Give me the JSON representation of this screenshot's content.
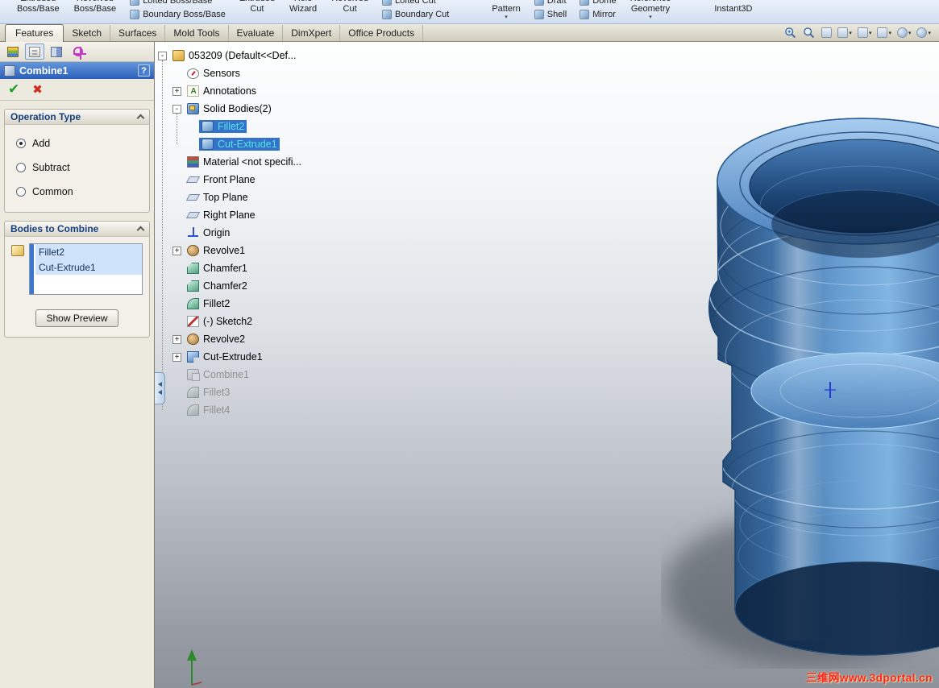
{
  "glyphs": {
    "dropdown": "▾",
    "ok": "✔",
    "cancel": "✖",
    "help": "?",
    "collapse": "-",
    "expand": "+"
  },
  "ribbon": {
    "items": [
      {
        "style": "big",
        "top": "Extruded",
        "bottom": "Boss/Base",
        "dropdown": false
      },
      {
        "style": "big",
        "top": "Revolved",
        "bottom": "Boss/Base",
        "dropdown": false
      },
      {
        "style": "stack",
        "top": "Lofted Boss/Base",
        "bottom": "Boundary Boss/Base"
      },
      {
        "style": "big",
        "top": "Extruded",
        "bottom": "Cut",
        "dropdown": false
      },
      {
        "style": "big",
        "top": "Hole",
        "bottom": "Wizard",
        "dropdown": false
      },
      {
        "style": "big",
        "top": "Revolved",
        "bottom": "Cut",
        "dropdown": false
      },
      {
        "style": "stack",
        "top": "Lofted Cut",
        "bottom": "Boundary Cut"
      },
      {
        "style": "big",
        "top": "",
        "bottom": "Pattern",
        "dropdown": true,
        "gap_before": true
      },
      {
        "style": "stack",
        "top": "Draft",
        "bottom": "Shell"
      },
      {
        "style": "stack",
        "top": "Dome",
        "bottom": "Mirror"
      },
      {
        "style": "big",
        "top": "Reference",
        "bottom": "Geometry",
        "dropdown": true
      },
      {
        "style": "big",
        "top": "",
        "bottom": "Instant3D",
        "dropdown": false,
        "gap_before": true
      }
    ]
  },
  "command_tabs": {
    "tabs": [
      {
        "label": "Features",
        "active": true
      },
      {
        "label": "Sketch",
        "active": false
      },
      {
        "label": "Surfaces",
        "active": false
      },
      {
        "label": "Mold Tools",
        "active": false
      },
      {
        "label": "Evaluate",
        "active": false
      },
      {
        "label": "DimXpert",
        "active": false
      },
      {
        "label": "Office Products",
        "active": false
      }
    ],
    "view_icons": [
      {
        "name": "zoom-window-icon",
        "glyph": "magnifier-plus",
        "dropdown": false
      },
      {
        "name": "zoom-fit-icon",
        "glyph": "magnifier",
        "dropdown": false
      },
      {
        "name": "section-view-icon",
        "glyph": "box",
        "dropdown": false
      },
      {
        "name": "view-orientation-icon",
        "glyph": "box",
        "dropdown": true
      },
      {
        "name": "display-style-icon",
        "glyph": "box",
        "dropdown": true
      },
      {
        "name": "hide-show-items-icon",
        "glyph": "box",
        "dropdown": true
      },
      {
        "name": "edit-appearance-icon",
        "glyph": "ball",
        "dropdown": true
      },
      {
        "name": "apply-scene-icon",
        "glyph": "ball",
        "dropdown": true
      }
    ]
  },
  "property_manager": {
    "tabs": [
      {
        "name": "featuremanager",
        "active": false
      },
      {
        "name": "propertymanager",
        "active": true
      },
      {
        "name": "configurationmanager",
        "active": false
      },
      {
        "name": "dimxpertmanager",
        "active": false
      }
    ],
    "title": "Combine1",
    "operation_type": {
      "title": "Operation Type",
      "options": [
        {
          "label": "Add",
          "selected": true
        },
        {
          "label": "Subtract",
          "selected": false
        },
        {
          "label": "Common",
          "selected": false
        }
      ]
    },
    "bodies_to_combine": {
      "title": "Bodies to Combine",
      "items": [
        "Fillet2",
        "Cut-Extrude1"
      ],
      "show_preview_label": "Show Preview"
    }
  },
  "feature_tree": {
    "items": [
      {
        "label": "053209 (Default<<Def...",
        "icon": "part",
        "level": 0,
        "expand": "minus"
      },
      {
        "label": "Sensors",
        "icon": "sensors",
        "level": 1
      },
      {
        "label": "Annotations",
        "icon": "annotations",
        "level": 1,
        "expand": "plus"
      },
      {
        "label": "Solid Bodies(2)",
        "icon": "solid-bodies",
        "level": 1,
        "expand": "minus"
      },
      {
        "label": "Fillet2",
        "icon": "body",
        "level": 2,
        "selected": true
      },
      {
        "label": "Cut-Extrude1",
        "icon": "body",
        "level": 2,
        "selected": true
      },
      {
        "label": "Material <not specifi...",
        "icon": "material",
        "level": 1
      },
      {
        "label": "Front Plane",
        "icon": "plane",
        "level": 1
      },
      {
        "label": "Top Plane",
        "icon": "plane",
        "level": 1
      },
      {
        "label": "Right Plane",
        "icon": "plane",
        "level": 1
      },
      {
        "label": "Origin",
        "icon": "origin",
        "level": 1
      },
      {
        "label": "Revolve1",
        "icon": "revolve",
        "level": 1,
        "expand": "plus"
      },
      {
        "label": "Chamfer1",
        "icon": "chamfer",
        "level": 1
      },
      {
        "label": "Chamfer2",
        "icon": "chamfer",
        "level": 1
      },
      {
        "label": "Fillet2",
        "icon": "fillet",
        "level": 1
      },
      {
        "label": "(-) Sketch2",
        "icon": "sketch",
        "level": 1
      },
      {
        "label": "Revolve2",
        "icon": "revolve",
        "level": 1,
        "expand": "plus"
      },
      {
        "label": "Cut-Extrude1",
        "icon": "cut-extrude",
        "level": 1,
        "expand": "plus"
      },
      {
        "label": "Combine1",
        "icon": "combine",
        "level": 1,
        "grayed": true
      },
      {
        "label": "Fillet3",
        "icon": "fillet",
        "level": 1,
        "grayed": true
      },
      {
        "label": "Fillet4",
        "icon": "fillet",
        "level": 1,
        "grayed": true
      }
    ]
  },
  "watermark": "三维网www.3dportal.cn",
  "colors": {
    "selection_bg": "#3472cc",
    "selection_text": "#55e6e0",
    "pm_header_blue": "#2a5fb8",
    "watermark_red": "#ff2222",
    "model_blue": "#4a86c8"
  }
}
